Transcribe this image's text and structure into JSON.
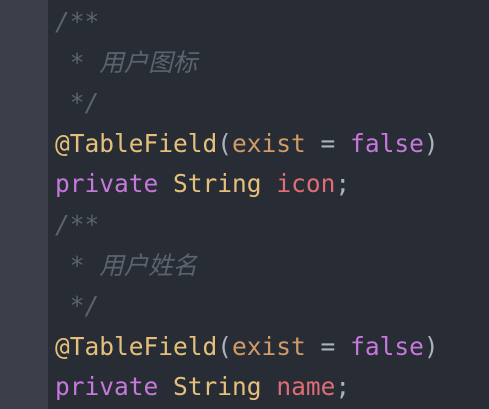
{
  "lines": [
    {
      "comment": "/**"
    },
    {
      "comment": " * 用户图标"
    },
    {
      "comment": " */"
    },
    {
      "annotation": "@TableField",
      "open": "(",
      "attr": "exist",
      "eq": " = ",
      "value": "false",
      "close": ")"
    },
    {
      "modifier": "private",
      "type": "String",
      "name": "icon",
      "semi": ";"
    },
    {
      "comment": "/**"
    },
    {
      "comment": " * 用户姓名"
    },
    {
      "comment": " */"
    },
    {
      "annotation": "@TableField",
      "open": "(",
      "attr": "exist",
      "eq": " = ",
      "value": "false",
      "close": ")"
    },
    {
      "modifier": "private",
      "type": "String",
      "name": "name",
      "semi": ";"
    }
  ]
}
